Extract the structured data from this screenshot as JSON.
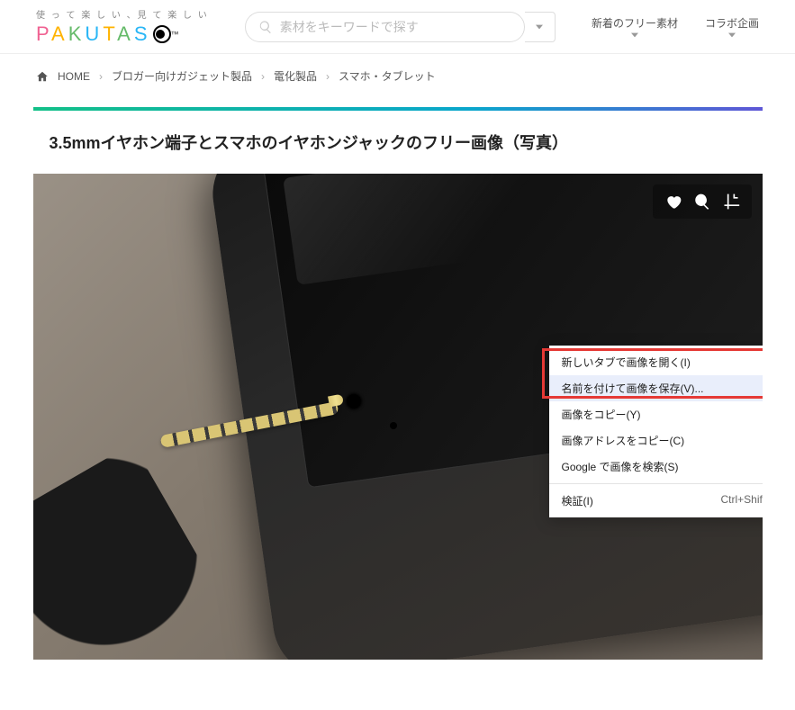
{
  "header": {
    "tagline": "使 っ て 楽 し い 、見 て 楽 し い",
    "logo_letters": "PAKUTAS",
    "tm": "™",
    "search_placeholder": "素材をキーワードで探す",
    "nav": [
      {
        "label": "新着のフリー素材"
      },
      {
        "label": "コラボ企画"
      }
    ]
  },
  "breadcrumb": {
    "home": "HOME",
    "items": [
      "ブロガー向けガジェット製品",
      "電化製品",
      "スマホ・タブレット"
    ]
  },
  "page": {
    "title": "3.5mmイヤホン端子とスマホのイヤホンジャックのフリー画像（写真）"
  },
  "context_menu": {
    "items": [
      {
        "label": "新しいタブで画像を開く(I)"
      },
      {
        "label": "名前を付けて画像を保存(V)...",
        "highlighted": true
      },
      {
        "label": "画像をコピー(Y)"
      },
      {
        "label": "画像アドレスをコピー(C)"
      },
      {
        "label": "Google で画像を検索(S)"
      }
    ],
    "inspect_label": "検証(I)",
    "inspect_shortcut": "Ctrl+Shift+I"
  },
  "logo_colors": [
    "#f06292",
    "#ffb300",
    "#66bb6a",
    "#29b6f6",
    "#ffb300",
    "#66bb6a",
    "#29b6f6"
  ]
}
